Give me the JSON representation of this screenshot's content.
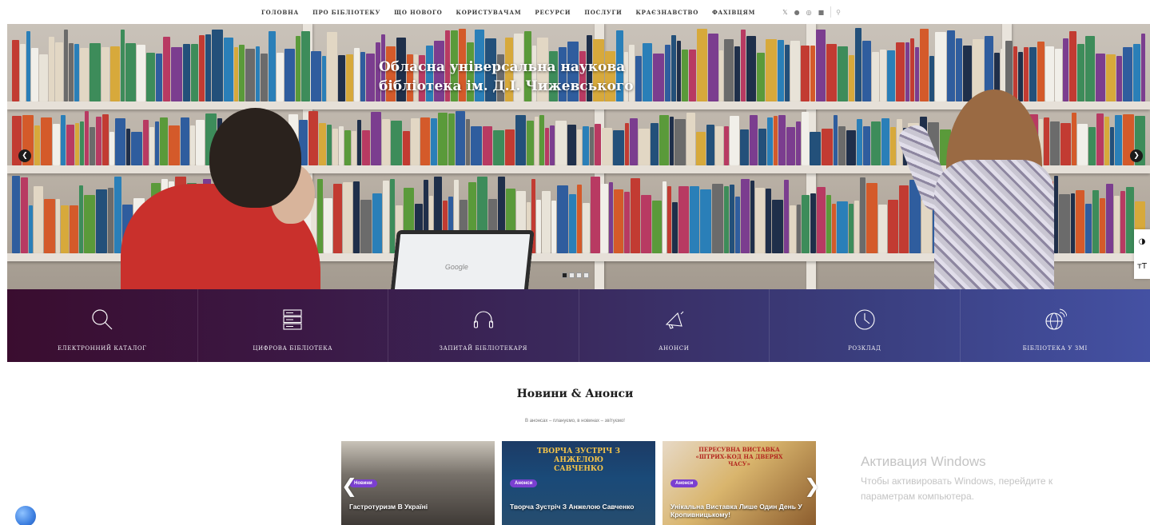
{
  "nav": {
    "items": [
      "ГОЛОВНА",
      "ПРО БІБЛІОТЕКУ",
      "ЩО НОВОГО",
      "КОРИСТУВАЧАМ",
      "РЕСУРСИ",
      "ПОСЛУГИ",
      "КРАЄЗНАВСТВО",
      "ФАХІВЦЯМ"
    ],
    "social_icons": [
      "twitter-icon",
      "facebook-icon",
      "instagram-icon",
      "youtube-icon"
    ],
    "search_icon": "search-icon"
  },
  "hero": {
    "title_line1": "Обласна універсальна наукова",
    "title_line2": "бібліотека ім. Д.І. Чижевського",
    "laptop_text": "Google",
    "slides_count": 4,
    "active_slide": 1
  },
  "tiles": [
    {
      "label": "ЕЛЕКТРОННИЙ КАТАЛОГ",
      "icon": "search-icon"
    },
    {
      "label": "ЦИФРОВА БІБЛІОТЕКА",
      "icon": "server-icon"
    },
    {
      "label": "ЗАПИТАЙ БІБЛІОТЕКАРЯ",
      "icon": "headphones-icon"
    },
    {
      "label": "АНОНСИ",
      "icon": "megaphone-icon"
    },
    {
      "label": "РОЗКЛАД",
      "icon": "clock-icon"
    },
    {
      "label": "БІБЛІОТЕКА У ЗМІ",
      "icon": "globe-signal-icon"
    }
  ],
  "news": {
    "title": "Новини & Анонси",
    "subtitle": "В анонсах – плануємо, в новинах – звітуємо!",
    "cards": [
      {
        "badge": "Новини",
        "title": "Гастротуризм В Україні"
      },
      {
        "badge": "Анонси",
        "title": "Творча Зустріч З Анжелою Савченко",
        "deco": "ТВОРЧА ЗУСТРІЧ З АНЖЕЛОЮ САВЧЕНКО"
      },
      {
        "badge": "Анонси",
        "title": "Унікальна Виставка Лише Один День У Кропивницькому!",
        "deco": "ПЕРЕСУВНА ВИСТАВКА «ШТРИХ-КОД НА ДВЕРЯХ ЧАСУ»"
      }
    ]
  },
  "windows_activation": {
    "title": "Активация Windows",
    "line1": "Чтобы активировать Windows, перейдите к",
    "line2": "параметрам компьютера."
  },
  "side_widgets": {
    "contrast_icon": "contrast-icon",
    "font_size": "тТ"
  },
  "colors": {
    "tile_start": "#3a0d2f",
    "tile_end": "#4451a3",
    "badge": "#7b3fd1"
  }
}
